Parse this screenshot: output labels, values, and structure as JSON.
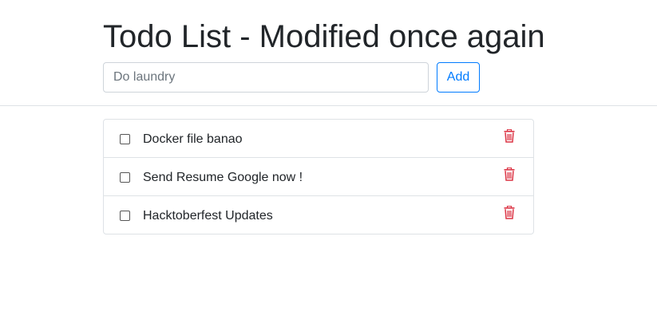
{
  "page": {
    "title": "Todo List - Modified once again"
  },
  "form": {
    "input_placeholder": "Do laundry",
    "input_value": "",
    "add_label": "Add"
  },
  "todos": [
    {
      "text": "Docker file banao",
      "done": false
    },
    {
      "text": "Send Resume Google now !",
      "done": false
    },
    {
      "text": "Hacktoberfest Updates",
      "done": false
    }
  ],
  "icons": {
    "delete": "trash-icon"
  },
  "colors": {
    "primary": "#007bff",
    "danger": "#dc3545",
    "border": "#dee2e6",
    "text": "#212529"
  }
}
